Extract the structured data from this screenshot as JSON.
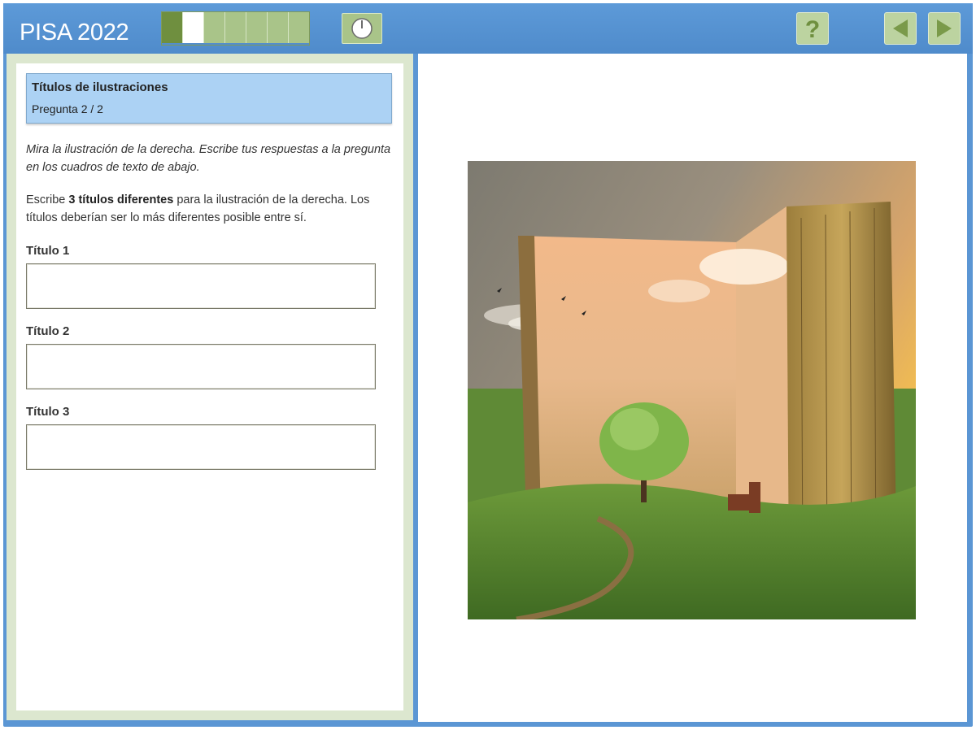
{
  "header": {
    "app_title": "PISA 2022",
    "progress": {
      "total": 7,
      "done": 1,
      "current": 2
    },
    "timer_icon": "clock-icon",
    "help_icon": "help-question-icon",
    "back_icon": "arrow-left-icon",
    "forward_icon": "arrow-right-icon"
  },
  "question": {
    "title": "Títulos de ilustraciones",
    "counter": "Pregunta 2 / 2",
    "instructions": "Mira la ilustración de la derecha. Escribe tus respuestas a la pregunta en los cuadros de texto de abajo.",
    "prompt_pre": "Escribe ",
    "prompt_bold": "3 títulos diferentes",
    "prompt_post": " para la ilustración de la derecha. Los títulos deberían ser lo más diferentes posible entre sí.",
    "fields": [
      {
        "label": "Título 1",
        "value": ""
      },
      {
        "label": "Título 2",
        "value": ""
      },
      {
        "label": "Título 3",
        "value": ""
      }
    ]
  },
  "illustration": {
    "subject": "open-book-landscape-illustration"
  },
  "colors": {
    "header_blue": "#5b96d4",
    "progress_done": "#6f8f3f",
    "progress_pending": "#a9c489",
    "question_header": "#acd2f4",
    "left_frame": "#dce7cf"
  }
}
